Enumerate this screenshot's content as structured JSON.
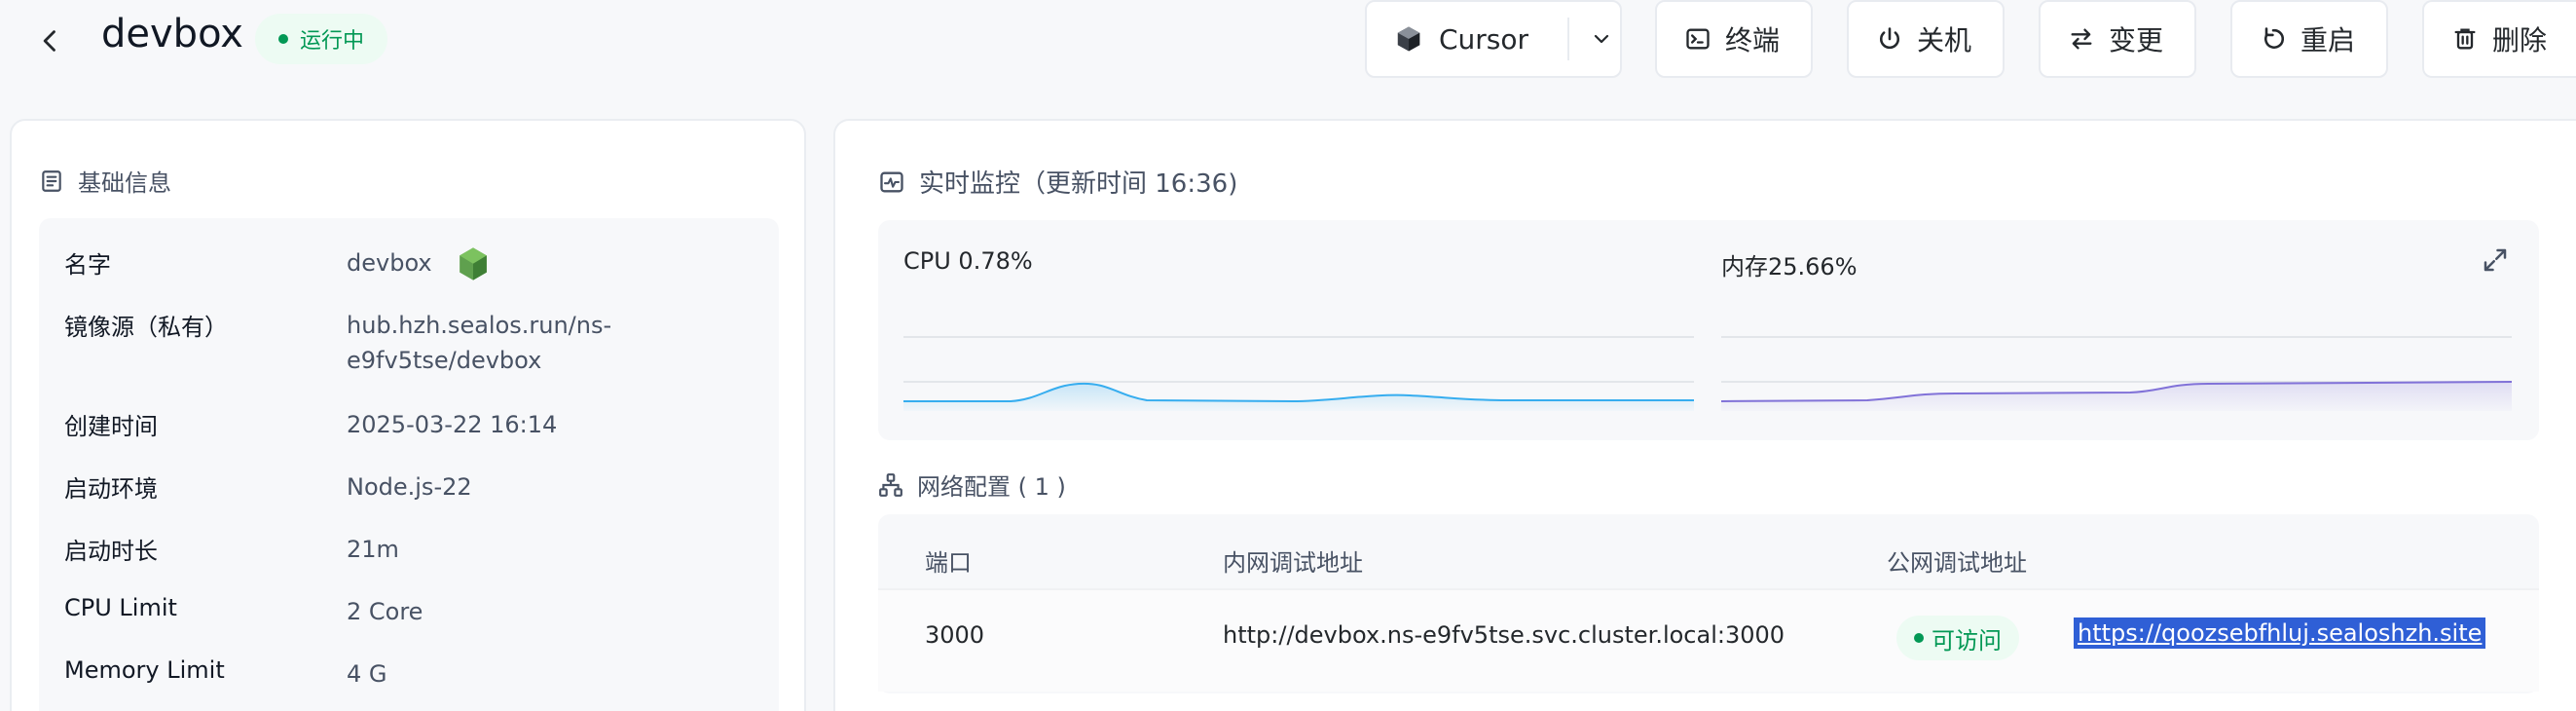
{
  "header": {
    "title": "devbox",
    "status": "运行中",
    "buttons": {
      "ide": "Cursor",
      "terminal": "终端",
      "power": "关机",
      "change": "变更",
      "restart": "重启",
      "delete": "删除"
    }
  },
  "basic_info": {
    "heading": "基础信息",
    "rows": [
      {
        "label": "名字",
        "value": "devbox"
      },
      {
        "label": "镜像源（私有）",
        "value_line1": "hub.hzh.sealos.run/ns-",
        "value_line2": "e9fv5tse/devbox"
      },
      {
        "label": "创建时间",
        "value": "2025-03-22 16:14"
      },
      {
        "label": "启动环境",
        "value": "Node.js-22"
      },
      {
        "label": "启动时长",
        "value": "21m"
      },
      {
        "label": "CPU Limit",
        "value": "2 Core"
      },
      {
        "label": "Memory Limit",
        "value": "4 G"
      }
    ]
  },
  "monitor": {
    "heading": "实时监控（更新时间  16:36)",
    "cpu_label": "CPU 0.78%",
    "memory_label": "内存25.66%",
    "colors": {
      "cpu": "#36ADEF",
      "memory": "#8172D8"
    }
  },
  "network": {
    "heading": "网络配置 ( 1 )",
    "columns": [
      "端口",
      "内网调试地址",
      "公网调试地址"
    ],
    "rows": [
      {
        "port": "3000",
        "internal": "http://devbox.ns-e9fv5tse.svc.cluster.local:3000",
        "status": "可访问",
        "public": "https://qoozsebfhluj.sealoshzh.site"
      }
    ]
  }
}
